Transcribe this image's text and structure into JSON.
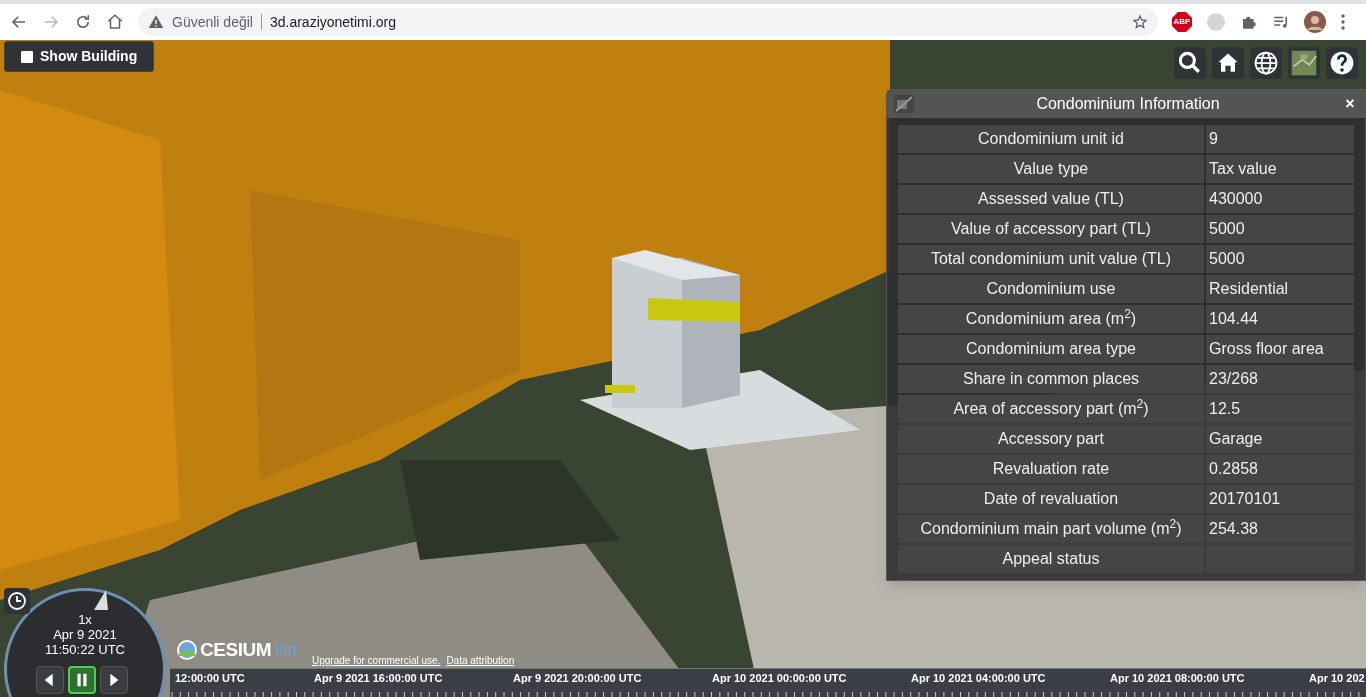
{
  "browser": {
    "forward_disabled": true,
    "security_label": "Güvenli değil",
    "url": "3d.araziyonetimi.org",
    "adblock_label": "ABP"
  },
  "show_building": {
    "label": "Show Building",
    "checked": false
  },
  "panel": {
    "title": "Condominium Information",
    "close": "×",
    "rows": [
      {
        "label": "Condominium unit id",
        "value": "9"
      },
      {
        "label": "Value type",
        "value": "Tax value"
      },
      {
        "label": "Assessed value (TL)",
        "value": "430000"
      },
      {
        "label": "Value of accessory part (TL)",
        "value": "5000"
      },
      {
        "label": "Total condominium unit value (TL)",
        "value": "5000"
      },
      {
        "label": "Condominium use",
        "value": "Residential"
      },
      {
        "label": "Condominium area (m$^{2}$)",
        "value": "104.44"
      },
      {
        "label": "Condominium area type",
        "value": "Gross floor area"
      },
      {
        "label": "Share in common places",
        "value": "23/268"
      },
      {
        "label": "Area of accessory part (m$^{2}$)",
        "value": "12.5"
      },
      {
        "label": "Accessory part",
        "value": "Garage"
      },
      {
        "label": "Revaluation rate",
        "value": "0.2858"
      },
      {
        "label": "Date of revaluation",
        "value": "20170101"
      },
      {
        "label": "Condominium main part volume (m$^{2}$)",
        "value": "254.38"
      },
      {
        "label": "Appeal status"
      }
    ]
  },
  "animation": {
    "speed": "1x",
    "date": "Apr 9 2021",
    "time": "11:50:22 UTC",
    "buttons": [
      {
        "kind": "reverse",
        "selected": false
      },
      {
        "kind": "pause",
        "selected": true
      },
      {
        "kind": "play",
        "selected": false
      }
    ]
  },
  "credits": {
    "logo_text": "CESIUM",
    "logo_suffix": "ion",
    "links": [
      "Upgrade for commercial use.",
      "Data attribution"
    ]
  },
  "timeline": {
    "labels": [
      "12:00:00 UTC",
      "Apr 9 2021 16:00:00 UTC",
      "Apr 9 2021 20:00:00 UTC",
      "Apr 10 2021 00:00:00 UTC",
      "Apr 10 2021 04:00:00 UTC",
      "Apr 10 2021 08:00:00 UTC",
      "Apr 10 202"
    ]
  }
}
